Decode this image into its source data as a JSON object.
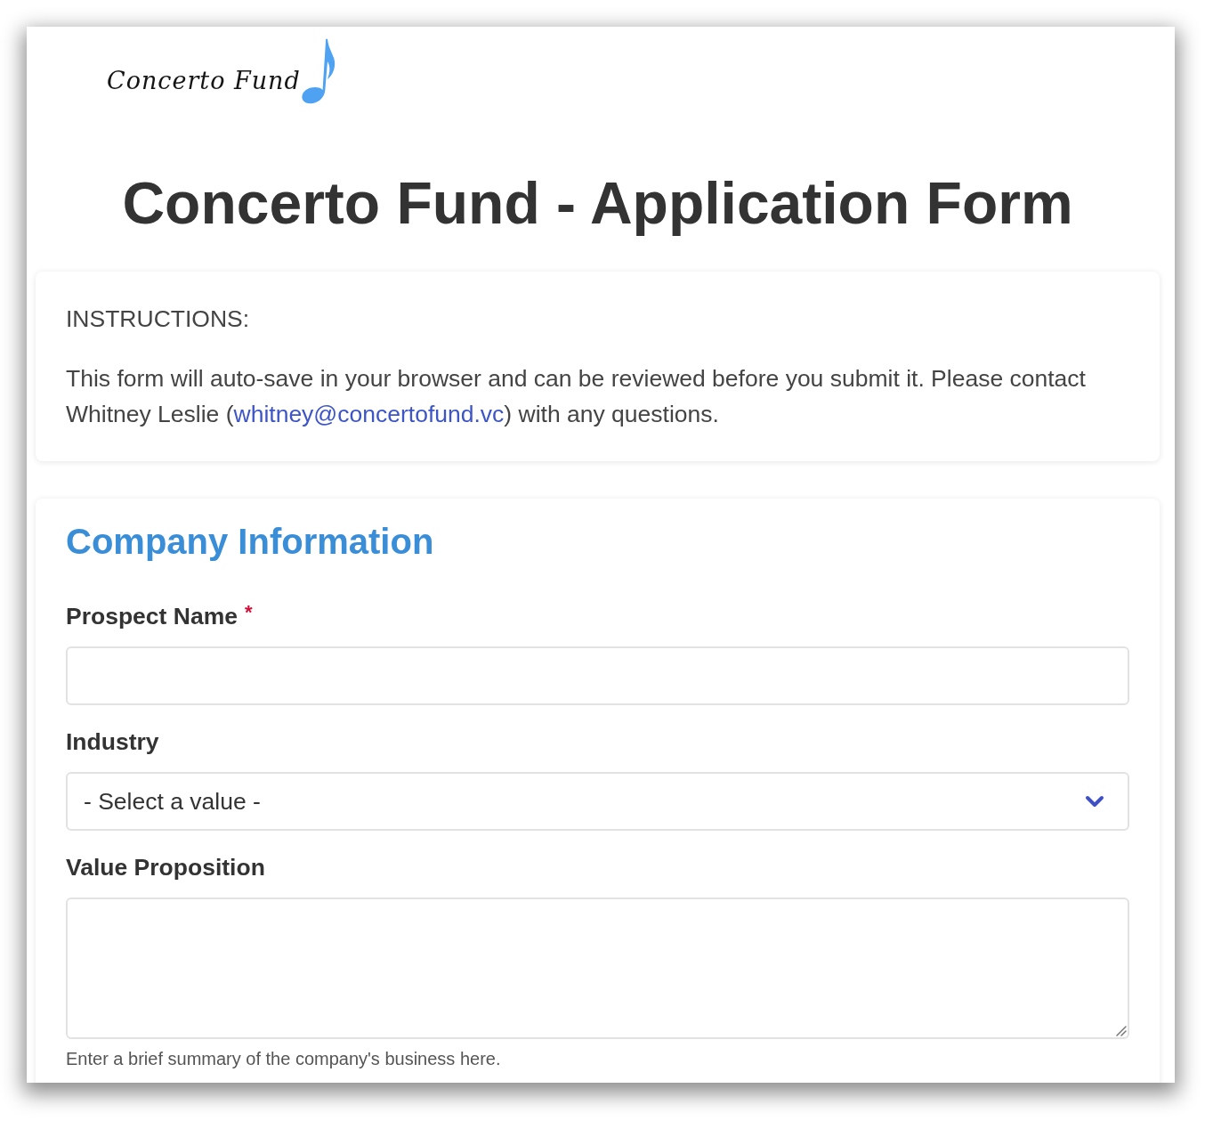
{
  "logo": {
    "text": "Concerto Fund"
  },
  "title": "Concerto Fund - Application Form",
  "instructions": {
    "heading": "INSTRUCTIONS:",
    "text_before": "This form will auto-save in your browser and can be reviewed before you submit it. Please contact Whitney Leslie (",
    "link": "whitney@concertofund.vc",
    "text_after": ") with any questions."
  },
  "section": {
    "title": "Company Information",
    "fields": [
      {
        "kind": "text",
        "label": "Prospect Name",
        "required_mark": "*"
      },
      {
        "kind": "select",
        "label": "Industry",
        "value": "- Select a value -"
      },
      {
        "kind": "textarea",
        "label": "Value Proposition",
        "help": "Enter a brief summary of the company's business here."
      }
    ]
  }
}
